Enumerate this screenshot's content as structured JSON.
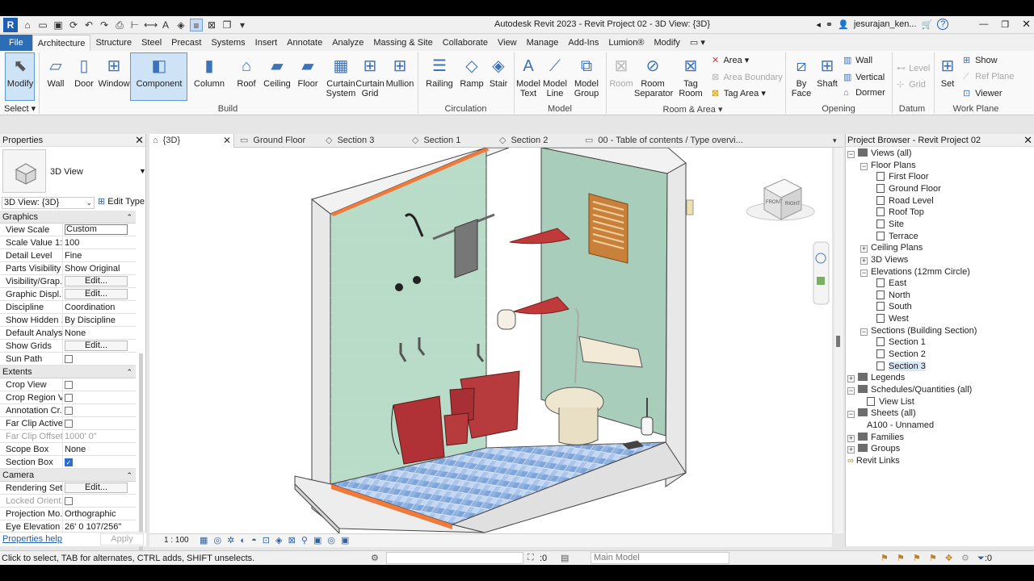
{
  "window": {
    "title": "Autodesk Revit 2023 - Revit Project 02 - 3D View: {3D}",
    "user": "jesurajan_ken...",
    "app_letter": "R"
  },
  "tabs": [
    "File",
    "Architecture",
    "Structure",
    "Steel",
    "Precast",
    "Systems",
    "Insert",
    "Annotate",
    "Analyze",
    "Massing & Site",
    "Collaborate",
    "View",
    "Manage",
    "Add-Ins",
    "Lumion®",
    "Modify"
  ],
  "ribbon": {
    "modify": "Modify",
    "select": "Select",
    "build": {
      "label": "Build",
      "wall": "Wall",
      "door": "Door",
      "window": "Window",
      "component": "Component",
      "column": "Column",
      "roof": "Roof",
      "ceiling": "Ceiling",
      "floor": "Floor",
      "curtain_system_1": "Curtain",
      "curtain_system_2": "System",
      "curtain_grid_1": "Curtain",
      "curtain_grid_2": "Grid",
      "mullion": "Mullion"
    },
    "circulation": {
      "label": "Circulation",
      "railing": "Railing",
      "ramp": "Ramp",
      "stair": "Stair"
    },
    "model": {
      "label": "Model",
      "text_1": "Model",
      "text_2": "Text",
      "line_1": "Model",
      "line_2": "Line",
      "group_1": "Model",
      "group_2": "Group"
    },
    "room_area": {
      "label": "Room & Area",
      "room": "Room",
      "room_sep_1": "Room",
      "room_sep_2": "Separator",
      "tag_room_1": "Tag",
      "tag_room_2": "Room",
      "area": "Area",
      "area_boundary": "Area  Boundary",
      "tag_area": "Tag  Area"
    },
    "opening": {
      "label": "Opening",
      "by_face_1": "By",
      "by_face_2": "Face",
      "shaft": "Shaft",
      "wall": "Wall",
      "vertical": "Vertical",
      "dormer": "Dormer"
    },
    "datum": {
      "label": "Datum",
      "level": "Level",
      "grid": "Grid"
    },
    "work_plane": {
      "label": "Work Plane",
      "set": "Set",
      "show": "Show",
      "ref_plane": "Ref  Plane",
      "viewer": "Viewer"
    }
  },
  "properties": {
    "title": "Properties",
    "type_name": "3D View",
    "instance": "3D View: {3D}",
    "edit_type": "Edit Type",
    "groups": [
      {
        "name": "Graphics",
        "rows": [
          {
            "k": "View Scale",
            "v": "Custom",
            "kind": "box"
          },
          {
            "k": "Scale Value    1:",
            "v": "100",
            "kind": "text"
          },
          {
            "k": "Detail Level",
            "v": "Fine",
            "kind": "text"
          },
          {
            "k": "Parts Visibility",
            "v": "Show Original",
            "kind": "text"
          },
          {
            "k": "Visibility/Grap...",
            "v": "Edit...",
            "kind": "btn"
          },
          {
            "k": "Graphic Displ...",
            "v": "Edit...",
            "kind": "btn"
          },
          {
            "k": "Discipline",
            "v": "Coordination",
            "kind": "text"
          },
          {
            "k": "Show Hidden ...",
            "v": "By Discipline",
            "kind": "text"
          },
          {
            "k": "Default Analys...",
            "v": "None",
            "kind": "text"
          },
          {
            "k": "Show Grids",
            "v": "Edit...",
            "kind": "btn"
          },
          {
            "k": "Sun Path",
            "v": "",
            "kind": "cb"
          }
        ]
      },
      {
        "name": "Extents",
        "rows": [
          {
            "k": "Crop View",
            "v": "",
            "kind": "cb"
          },
          {
            "k": "Crop Region V...",
            "v": "",
            "kind": "cb"
          },
          {
            "k": "Annotation Cr...",
            "v": "",
            "kind": "cb"
          },
          {
            "k": "Far Clip Active",
            "v": "",
            "kind": "cb"
          },
          {
            "k": "Far Clip Offset",
            "v": "1000'  0\"",
            "kind": "text",
            "dis": true
          },
          {
            "k": "Scope Box",
            "v": "None",
            "kind": "text"
          },
          {
            "k": "Section Box",
            "v": "",
            "kind": "cbon"
          }
        ]
      },
      {
        "name": "Camera",
        "rows": [
          {
            "k": "Rendering Set...",
            "v": "Edit...",
            "kind": "btn"
          },
          {
            "k": "Locked Orient...",
            "v": "",
            "kind": "cb",
            "dis": true
          },
          {
            "k": "Projection Mo...",
            "v": "Orthographic",
            "kind": "text"
          },
          {
            "k": "Eye Elevation",
            "v": "26'  0 107/256\"",
            "kind": "text"
          }
        ]
      }
    ],
    "help": "Properties help",
    "apply": "Apply"
  },
  "view_tabs": [
    "{3D}",
    "Ground Floor",
    "Section 3",
    "Section 1",
    "Section 2",
    "00 - Table of contents / Type overvi..."
  ],
  "view_scale": "1 : 100",
  "browser": {
    "title": "Project Browser - Revit Project 02",
    "rows": [
      {
        "t": "Views (all)",
        "l": 0,
        "tg": "-",
        "ic": "views"
      },
      {
        "t": "Floor Plans",
        "l": 1,
        "tg": "-"
      },
      {
        "t": "First Floor",
        "l": 2,
        "ic": "page"
      },
      {
        "t": "Ground Floor",
        "l": 2,
        "ic": "page"
      },
      {
        "t": "Road Level",
        "l": 2,
        "ic": "page"
      },
      {
        "t": "Roof Top",
        "l": 2,
        "ic": "page"
      },
      {
        "t": "Site",
        "l": 2,
        "ic": "page"
      },
      {
        "t": "Terrace",
        "l": 2,
        "ic": "page"
      },
      {
        "t": "Ceiling Plans",
        "l": 1,
        "tg": "+"
      },
      {
        "t": "3D Views",
        "l": 1,
        "tg": "+"
      },
      {
        "t": "Elevations (12mm Circle)",
        "l": 1,
        "tg": "-"
      },
      {
        "t": "East",
        "l": 2,
        "ic": "page"
      },
      {
        "t": "North",
        "l": 2,
        "ic": "page"
      },
      {
        "t": "South",
        "l": 2,
        "ic": "page"
      },
      {
        "t": "West",
        "l": 2,
        "ic": "page"
      },
      {
        "t": "Sections (Building Section)",
        "l": 1,
        "tg": "-"
      },
      {
        "t": "Section 1",
        "l": 2,
        "ic": "page"
      },
      {
        "t": "Section 2",
        "l": 2,
        "ic": "page"
      },
      {
        "t": "Section 3",
        "l": 2,
        "ic": "page",
        "sel": true
      },
      {
        "t": "Legends",
        "l": 0,
        "tg": "+",
        "ic": "fi"
      },
      {
        "t": "Schedules/Quantities (all)",
        "l": 0,
        "tg": "-",
        "ic": "fi"
      },
      {
        "t": "View List",
        "l": 1.5,
        "ic": "page"
      },
      {
        "t": "Sheets (all)",
        "l": 0,
        "tg": "-",
        "ic": "fi"
      },
      {
        "t": "A100 - Unnamed",
        "l": 1.5
      },
      {
        "t": "Families",
        "l": 0,
        "tg": "+",
        "ic": "fi"
      },
      {
        "t": "Groups",
        "l": 0,
        "tg": "+",
        "ic": "fi"
      },
      {
        "t": "Revit Links",
        "l": 0,
        "ic": "link"
      }
    ]
  },
  "status": {
    "message": "Click to select, TAB for alternates, CTRL adds, SHIFT unselects.",
    "count1": ":0",
    "model": "Main Model",
    "filter": ":0"
  },
  "viewcube": {
    "front": "FRONT",
    "right": "RIGHT"
  }
}
